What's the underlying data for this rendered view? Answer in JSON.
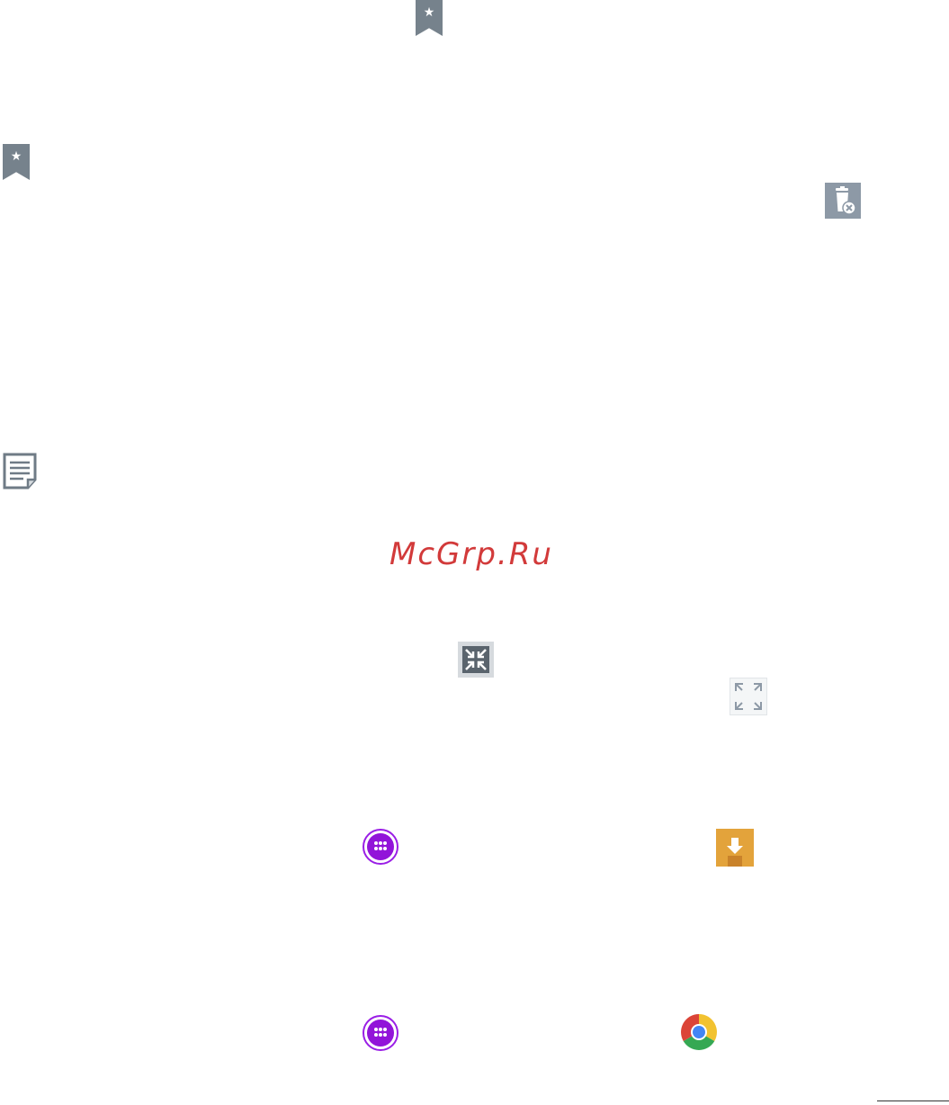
{
  "watermark": {
    "text": "McGrp.Ru",
    "color": "#d23a3a"
  },
  "icons": {
    "bookmark": "bookmark-icon",
    "delete_bookmark": "delete-bookmark-icon",
    "memo": "memo-icon",
    "reduce_view": "reduce-view-icon",
    "expand_view": "expand-view-icon",
    "apps": "apps-icon",
    "downloads": "downloads-icon",
    "chrome": "chrome-icon"
  },
  "colors": {
    "icon_gray": "#76828c",
    "apps_purple": "#9214d9",
    "download_orange": "#e3a33b"
  }
}
